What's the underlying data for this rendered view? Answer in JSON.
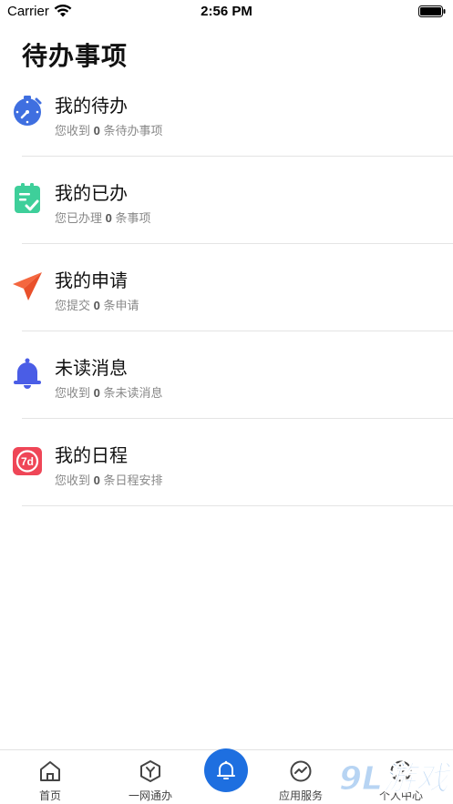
{
  "status_bar": {
    "carrier": "Carrier",
    "time": "2:56 PM"
  },
  "page": {
    "title": "待办事项"
  },
  "items": [
    {
      "title": "我的待办",
      "sub_prefix": "您收到",
      "count": "0",
      "sub_suffix": "条待办事项",
      "icon": "clock-icon",
      "color": "#3f6fe0"
    },
    {
      "title": "我的已办",
      "sub_prefix": "您已办理",
      "count": "0",
      "sub_suffix": "条事项",
      "icon": "clipboard-check-icon",
      "color": "#3ecf9a"
    },
    {
      "title": "我的申请",
      "sub_prefix": "您提交",
      "count": "0",
      "sub_suffix": "条申请",
      "icon": "paper-plane-icon",
      "color": "#f4673f"
    },
    {
      "title": "未读消息",
      "sub_prefix": "您收到",
      "count": "0",
      "sub_suffix": "条未读消息",
      "icon": "bell-icon",
      "color": "#4a5de6"
    },
    {
      "title": "我的日程",
      "sub_prefix": "您收到",
      "count": "0",
      "sub_suffix": "条日程安排",
      "icon": "calendar-7d-icon",
      "color": "#ef4657"
    }
  ],
  "tab_bar": {
    "tabs": [
      {
        "label": "首页",
        "icon": "home-icon"
      },
      {
        "label": "一网通办",
        "icon": "hexagon-y-icon"
      },
      {
        "label": "",
        "icon": "bell-icon"
      },
      {
        "label": "应用服务",
        "icon": "chart-circle-icon"
      },
      {
        "label": "个人中心",
        "icon": "user-icon"
      }
    ],
    "accent": "#1e6fe0"
  },
  "watermark": {
    "text": "9L游戏"
  }
}
